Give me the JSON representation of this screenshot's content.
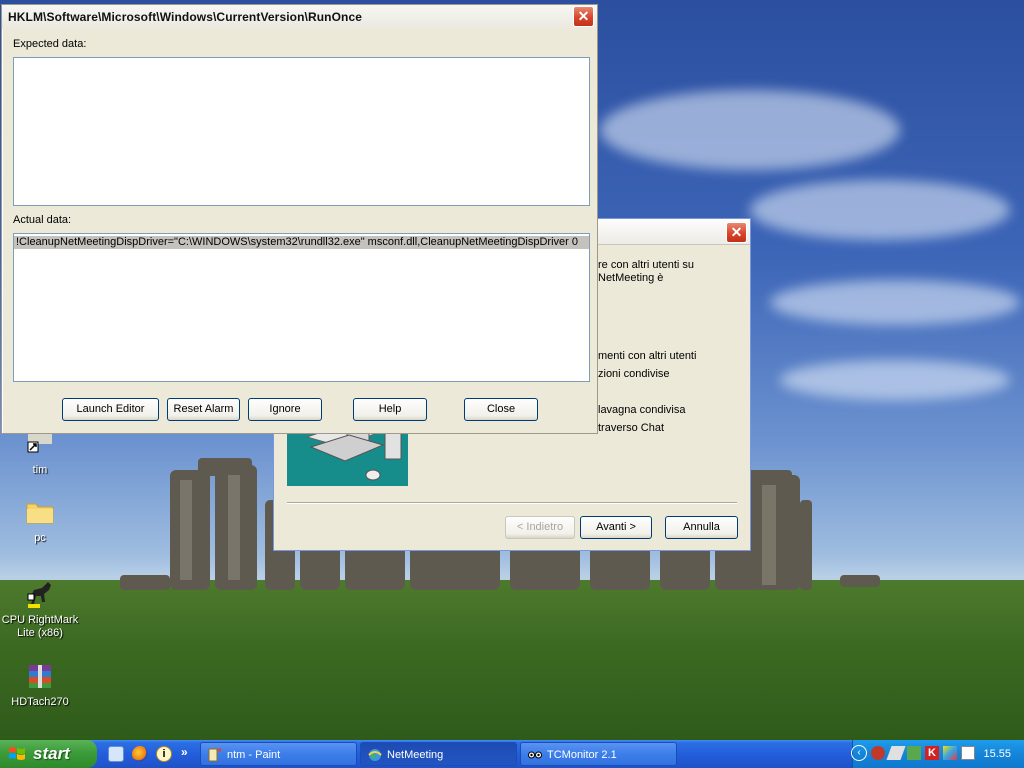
{
  "desktop": {
    "icons": [
      {
        "name": "tim",
        "icon": "shortcut-icon"
      },
      {
        "name": "pc",
        "icon": "folder-icon"
      },
      {
        "name": "CPU RightMark Lite (x86)",
        "icon": "horse-icon"
      },
      {
        "name": "HDTach270",
        "icon": "archive-icon"
      }
    ]
  },
  "registry_dialog": {
    "title": "HKLM\\Software\\Microsoft\\Windows\\CurrentVersion\\RunOnce",
    "expected_label": "Expected data:",
    "expected_rows": [],
    "actual_label": "Actual data:",
    "actual_rows": [
      "!CleanupNetMeetingDispDriver=\"C:\\WINDOWS\\system32\\rundll32.exe\" msconf.dll,CleanupNetMeetingDispDriver 0"
    ],
    "buttons": {
      "launch_editor": "Launch Editor",
      "reset_alarm": "Reset Alarm",
      "ignore": "Ignore",
      "help": "Help",
      "close": "Close"
    }
  },
  "wizard": {
    "text_lines": [
      "re con altri utenti su",
      "NetMeeting è",
      "menti con altri utenti",
      "zioni condivise",
      "lavagna condivisa",
      "traverso Chat"
    ],
    "buttons": {
      "back": "< Indietro",
      "next": "Avanti >",
      "cancel": "Annulla"
    }
  },
  "taskbar": {
    "start_label": "start",
    "quick_launch": [
      "ie-icon",
      "firefox-icon",
      "info-icon"
    ],
    "overflow": "»",
    "tasks": [
      {
        "label": "ntm - Paint",
        "active": false
      },
      {
        "label": "NetMeeting",
        "active": true
      },
      {
        "label": "TCMonitor 2.1",
        "active": false
      }
    ],
    "clock": "15.55"
  },
  "colors": {
    "window_face": "#ece9d8",
    "close_button": "#d8452b",
    "taskbar": "#245edb",
    "start_button": "#3c9c3a",
    "tray": "#1584d8",
    "selection": "#c4c2bd"
  }
}
